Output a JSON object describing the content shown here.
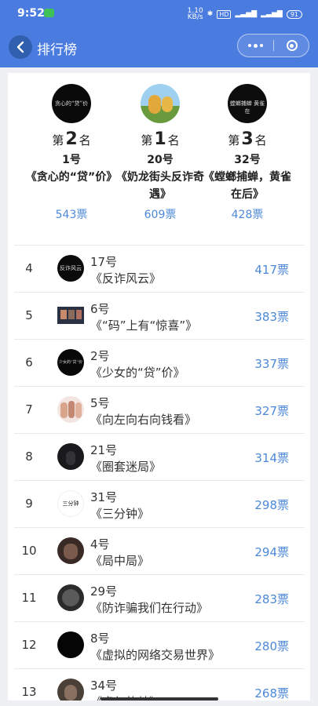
{
  "status_bar": {
    "time": "9:52",
    "network_speed": "1.10\nKB/s",
    "hd_badge": "HD",
    "battery": "91"
  },
  "nav": {
    "title": "排行榜"
  },
  "podium": [
    {
      "rank_prefix": "第",
      "rank": "2",
      "rank_suffix": "名",
      "number": "1号",
      "title": "《贪心的“贷”价》",
      "votes": "543票",
      "avatar_text": "贪心的“贷”价"
    },
    {
      "rank_prefix": "第",
      "rank": "1",
      "rank_suffix": "名",
      "number": "20号",
      "title": "《奶龙街头反诈奇遇》",
      "votes": "609票"
    },
    {
      "rank_prefix": "第",
      "rank": "3",
      "rank_suffix": "名",
      "number": "32号",
      "title": "《螳螂捕蝉，黄雀在后》",
      "votes": "428票",
      "avatar_text": "螳螂捕蝉 黄雀在"
    }
  ],
  "list": [
    {
      "rank": "4",
      "number": "17号",
      "title": "《反诈风云》",
      "votes": "417票",
      "avatar_text": "反诈风云"
    },
    {
      "rank": "5",
      "number": "6号",
      "title": "《“码”上有“惊喜”》",
      "votes": "383票"
    },
    {
      "rank": "6",
      "number": "2号",
      "title": "《少女的“贷”价》",
      "votes": "337票",
      "avatar_text": "少女的“贷”价"
    },
    {
      "rank": "7",
      "number": "5号",
      "title": "《向左向右向钱看》",
      "votes": "327票"
    },
    {
      "rank": "8",
      "number": "21号",
      "title": "《圈套迷局》",
      "votes": "314票"
    },
    {
      "rank": "9",
      "number": "31号",
      "title": "《三分钟》",
      "votes": "298票",
      "avatar_text": "三分钟"
    },
    {
      "rank": "10",
      "number": "4号",
      "title": "《局中局》",
      "votes": "294票"
    },
    {
      "rank": "11",
      "number": "29号",
      "title": "《防诈骗我们在行动》",
      "votes": "283票"
    },
    {
      "rank": "12",
      "number": "8号",
      "title": "《虚拟的网络交易世界》",
      "votes": "280票"
    },
    {
      "rank": "13",
      "number": "34号",
      "title": "《虚幻的梦》",
      "votes": "268票"
    }
  ],
  "colors": {
    "nav_bg": "#4a7ce0",
    "votes": "#4d88d8"
  }
}
